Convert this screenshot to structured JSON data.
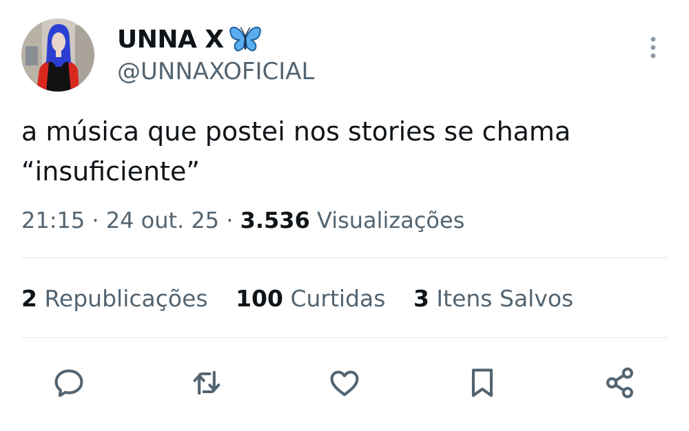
{
  "author": {
    "display_name": "UNNA X",
    "handle": "@UNNAXOFICIAL",
    "badge_icon": "butterfly-emoji"
  },
  "tweet": {
    "text": "a música que postei nos stories se chama\n“insuficiente”"
  },
  "meta": {
    "time": "21:15",
    "sep1": "·",
    "date": "24 out. 25",
    "sep2": "·",
    "views_count": "3.536",
    "views_label": "Visualizações"
  },
  "stats": {
    "reposts_count": "2",
    "reposts_label": "Republicações",
    "likes_count": "100",
    "likes_label": "Curtidas",
    "saves_count": "3",
    "saves_label": "Itens Salvos"
  },
  "icons": {
    "reply": "comment-icon",
    "repost": "repost-icon",
    "like": "heart-icon",
    "bookmark": "bookmark-icon",
    "share": "share-icon",
    "more": "more-vertical-icon"
  },
  "colors": {
    "text_primary": "#0f1419",
    "text_secondary": "#536471",
    "divider": "#e1e6ea",
    "butterfly": "#4fa3e8"
  }
}
